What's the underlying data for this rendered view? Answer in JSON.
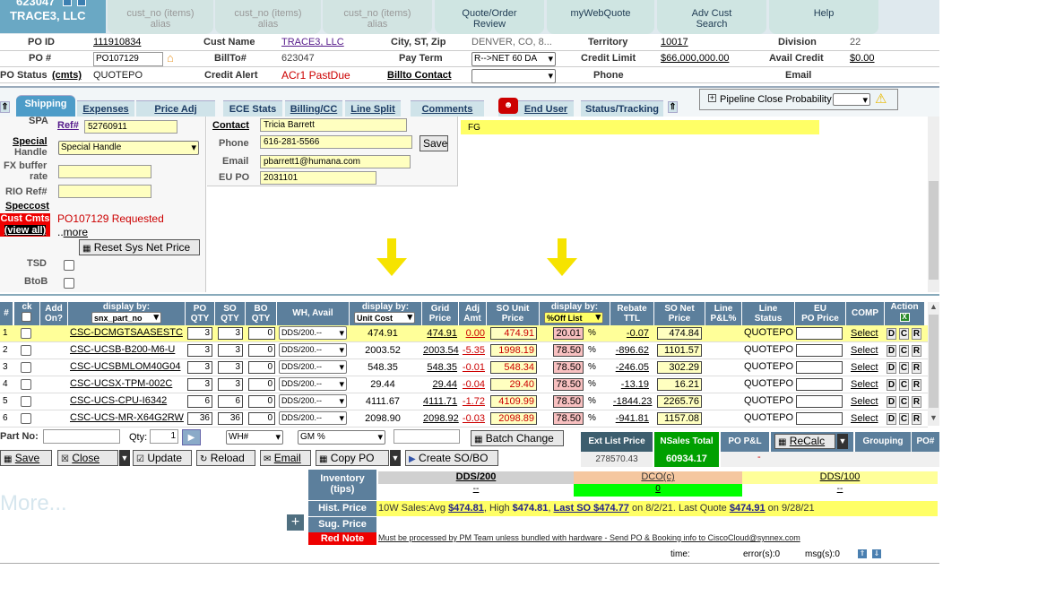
{
  "header": {
    "customer_number": "623047",
    "customer_name": "TRACE3, LLC",
    "mini_icon_1": "LB",
    "tabs": [
      {
        "line1": "cust_no (items)",
        "line2": "alias"
      },
      {
        "line1": "cust_no (items)",
        "line2": "alias"
      },
      {
        "line1": "cust_no (items)",
        "line2": "alias"
      },
      {
        "line1": "Quote/Order",
        "line2": "Review"
      },
      {
        "line1": "",
        "line2": "myWebQuote"
      },
      {
        "line1": "Adv Cust",
        "line2": "Search"
      },
      {
        "line1": "",
        "line2": "Help"
      }
    ]
  },
  "info": {
    "po_id_label": "PO ID",
    "po_id": "111910834",
    "po_num_label": "PO #",
    "po_num": "PO107129",
    "po_status_label": "PO Status",
    "cmts": "(cmts)",
    "po_status": "QUOTEPO",
    "cust_name_label": "Cust Name",
    "cust_name": "TRACE3, LLC",
    "billto_label": "BillTo#",
    "billto": "623047",
    "credit_alert_label": "Credit Alert",
    "credit_alert": "ACr1 PastDue",
    "city_label": "City, ST, Zip",
    "city": "DENVER, CO, 8...",
    "payterm_label": "Pay Term",
    "payterm": "R-->NET 60 DA",
    "billto_contact": "Billto Contact",
    "territory_label": "Territory",
    "territory": "10017",
    "credit_limit_label": "Credit Limit",
    "credit_limit": "$66,000,000.00",
    "phone_label": "Phone",
    "division_label": "Division",
    "division": "22",
    "avail_credit_label": "Avail Credit",
    "avail_credit": "$0.00",
    "email_label": "Email"
  },
  "section_tabs": [
    "Shipping",
    "Expenses",
    "Price Adj",
    "ECE Stats",
    "Billing/CC",
    "Line Split",
    "Comments",
    "End User",
    "Status/Tracking"
  ],
  "pipeline": {
    "label": "Pipeline Close Probability"
  },
  "left_panel": {
    "spa": "SPA",
    "ref_label": "Ref#",
    "ref": "52760911",
    "special_label": "Special",
    "handle_label": "Handle",
    "special_value": "Special Handle",
    "fx_label1": "FX buffer",
    "fx_label2": "rate",
    "rio_label": "RIO Ref#",
    "speccost": "Speccost",
    "cust_cmts": "Cust Cmts",
    "view_all": "(view all)",
    "cmts_text": "PO107129 Requested",
    "more": "more",
    "reset_btn": "Reset Sys Net Price",
    "tsd": "TSD",
    "btob": "BtoB"
  },
  "contact": {
    "contact_label": "Contact",
    "contact": "Tricia Barrett",
    "phone_label": "Phone",
    "phone": "616-281-5566",
    "save": "Save",
    "email_label": "Email",
    "email": "pbarrett1@humana.com",
    "eupo_label": "EU PO",
    "eupo": "2031101"
  },
  "fg": "FG",
  "table": {
    "headers": {
      "num": "#",
      "ck": "ck",
      "add_on1": "Add",
      "add_on2": "On?",
      "display_by": "display by:",
      "display_sel": "snx_part_no",
      "po_qty1": "PO",
      "po_qty2": "QTY",
      "so_qty1": "SO",
      "so_qty2": "QTY",
      "bo_qty1": "BO",
      "bo_qty2": "QTY",
      "wh": "WH,  Avail",
      "cost_display": "display by:",
      "cost_sel": "Unit Cost",
      "grid1": "Grid",
      "grid2": "Price",
      "adj1": "Adj",
      "adj2": "Amt",
      "sounit1": "SO Unit",
      "sounit2": "Price",
      "pct_display": "display by:",
      "pct_sel": "%Off List",
      "rebate1": "Rebate",
      "rebate2": "TTL",
      "sonet1": "SO Net",
      "sonet2": "Price",
      "linepl1": "Line",
      "linepl2": "P&L%",
      "linest1": "Line",
      "linest2": "Status",
      "eupo1": "EU",
      "eupo2": "PO Price",
      "comp": "COMP",
      "action": "Action"
    },
    "rows": [
      {
        "n": "1",
        "part": "CSC-DCMGTSAASESTC",
        "po": "3",
        "so": "3",
        "bo": "0",
        "wh": "DDS/200.--",
        "cost": "474.91",
        "grid": "474.91",
        "adj": "0.00",
        "sounit": "474.91",
        "pct": "20.01",
        "rebate": "-0.07",
        "net": "474.84",
        "status": "QUOTEPO",
        "select": "Select"
      },
      {
        "n": "2",
        "part": "CSC-UCSB-B200-M6-U",
        "po": "3",
        "so": "3",
        "bo": "0",
        "wh": "DDS/200.--",
        "cost": "2003.52",
        "grid": "2003.54",
        "adj": "-5.35",
        "sounit": "1998.19",
        "pct": "78.50",
        "rebate": "-896.62",
        "net": "1101.57",
        "status": "QUOTEPO",
        "select": "Select"
      },
      {
        "n": "3",
        "part": "CSC-UCSBMLOM40G04",
        "po": "3",
        "so": "3",
        "bo": "0",
        "wh": "DDS/200.--",
        "cost": "548.35",
        "grid": "548.35",
        "adj": "-0.01",
        "sounit": "548.34",
        "pct": "78.50",
        "rebate": "-246.05",
        "net": "302.29",
        "status": "QUOTEPO",
        "select": "Select"
      },
      {
        "n": "4",
        "part": "CSC-UCSX-TPM-002C",
        "po": "3",
        "so": "3",
        "bo": "0",
        "wh": "DDS/200.--",
        "cost": "29.44",
        "grid": "29.44",
        "adj": "-0.04",
        "sounit": "29.40",
        "pct": "78.50",
        "rebate": "-13.19",
        "net": "16.21",
        "status": "QUOTEPO",
        "select": "Select"
      },
      {
        "n": "5",
        "part": "CSC-UCS-CPU-I6342",
        "po": "6",
        "so": "6",
        "bo": "0",
        "wh": "DDS/200.--",
        "cost": "4111.67",
        "grid": "4111.71",
        "adj": "-1.72",
        "sounit": "4109.99",
        "pct": "78.50",
        "rebate": "-1844.23",
        "net": "2265.76",
        "status": "QUOTEPO",
        "select": "Select"
      },
      {
        "n": "6",
        "part": "CSC-UCS-MR-X64G2RW",
        "po": "36",
        "so": "36",
        "bo": "0",
        "wh": "DDS/200.--",
        "cost": "2098.90",
        "grid": "2098.92",
        "adj": "-0.03",
        "sounit": "2098.89",
        "pct": "78.50",
        "rebate": "-941.81",
        "net": "1157.08",
        "status": "QUOTEPO",
        "select": "Select"
      }
    ],
    "pct_sign": "%",
    "actions": [
      "D",
      "C",
      "R"
    ]
  },
  "bottom": {
    "part_no_label": "Part No:",
    "qty_label": "Qty:",
    "qty": "1",
    "wh_sel": "WH#",
    "gm_sel": "GM %",
    "batch_change": "Batch Change",
    "ext_list_label": "Ext List Price",
    "ext_list": "278570.43",
    "nsales_label": "NSales Total",
    "nsales": "60934.17",
    "popl_label": "PO P&L",
    "popl": "-",
    "recalc": "ReCalc",
    "grouping": "Grouping",
    "po_hash": "PO#",
    "buttons": [
      "Save",
      "Close",
      "Update",
      "Reload",
      "Email",
      "Copy PO",
      "Create SO/BO"
    ],
    "more": "More...",
    "inventory_label": "Inventory (tips)",
    "inv_cols": [
      "DDS/200",
      "DCO(c)",
      "DDS/100"
    ],
    "inv_vals": [
      "--",
      "0",
      "--"
    ],
    "hist_label": "Hist. Price",
    "hist_text1": "10W Sales:Avg ",
    "hist_avg": "$474.81",
    "hist_text2": ", High ",
    "hist_high": "$474.81",
    "hist_last_so": "Last SO $474.77",
    "hist_text3": " on 8/2/21. Last Quote ",
    "hist_last_quote": "$474.91",
    "hist_text4": " on 9/28/21",
    "sug_label": "Sug. Price",
    "rednote_label": "Red Note",
    "rednote": "Must be processed by PM Team unless bundled with hardware - Send PO & Booking info to CiscoCloud@synnex.com",
    "time_label": "time:",
    "errors": "error(s):0",
    "msgs": "msg(s):0"
  },
  "colors": {
    "accent": "#5c7f9c",
    "highlight": "#ffff99",
    "green": "#00aa00"
  }
}
